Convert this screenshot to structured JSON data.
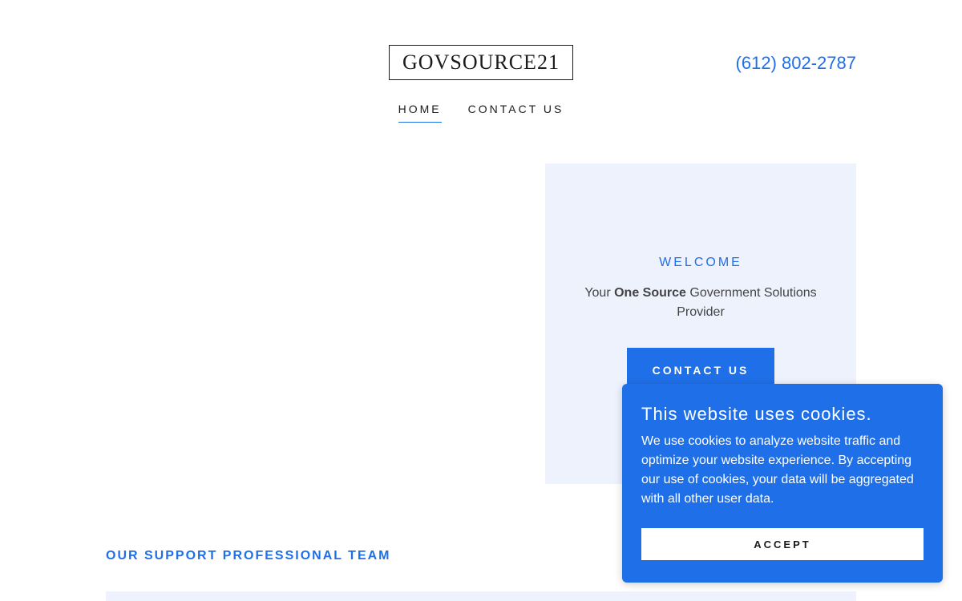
{
  "header": {
    "logo_text": "GOVSOURCE21",
    "phone": "(612) 802-2787",
    "nav": [
      {
        "label": "HOME",
        "active": true
      },
      {
        "label": "CONTACT US",
        "active": false
      }
    ]
  },
  "hero": {
    "welcome": "WELCOME",
    "tagline_prefix": "Your ",
    "tagline_bold": "One Source",
    "tagline_suffix": " Government Solutions Provider",
    "button_label": "CONTACT US"
  },
  "section": {
    "title": "OUR SUPPORT PROFESSIONAL TEAM"
  },
  "cookie_banner": {
    "title": "This website uses cookies.",
    "text": "We use cookies to analyze website traffic and optimize your website experience. By accepting our use of cookies, your data will be aggregated with all other user data.",
    "accept_label": "ACCEPT"
  },
  "colors": {
    "accent": "#1f6fe8",
    "card_bg": "#eef2fd",
    "text": "#1b1b1b"
  }
}
